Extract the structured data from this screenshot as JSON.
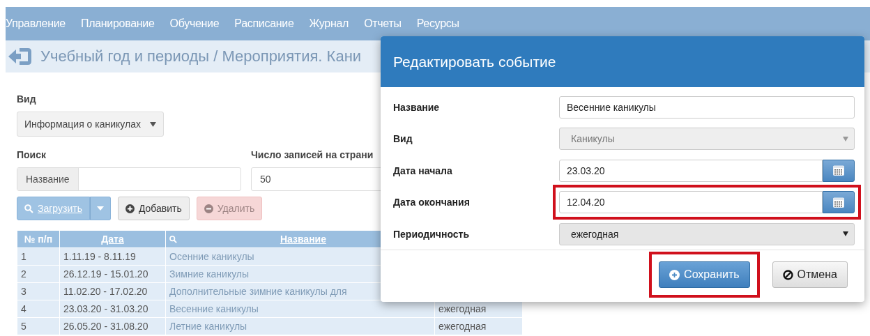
{
  "nav": {
    "items": [
      "Управление",
      "Планирование",
      "Обучение",
      "Расписание",
      "Журнал",
      "Отчеты",
      "Ресурсы"
    ]
  },
  "breadcrumb": {
    "title": "Учебный год и периоды / Мероприятия. Кани"
  },
  "filters": {
    "view_label": "Вид",
    "view_value": "Информация о каникулах",
    "search_label": "Поиск",
    "search_prefix": "Название",
    "per_page_label": "Число записей на страни",
    "per_page_value": "50"
  },
  "actions": [
    {
      "label": "Загрузить",
      "kind": "load"
    },
    {
      "label": "Добавить",
      "kind": "add"
    },
    {
      "label": "Удалить",
      "kind": "delete",
      "disabled": true
    }
  ],
  "table": {
    "columns": [
      "№ п/п",
      "Дата",
      "Название"
    ],
    "rows": [
      {
        "n": "1",
        "date": "1.11.19 - 8.11.19",
        "name": "Осенние каникулы"
      },
      {
        "n": "2",
        "date": "26.12.19 - 15.01.20",
        "name": "Зимние каникулы"
      },
      {
        "n": "3",
        "date": "11.02.20 - 17.02.20",
        "name": "Дополнительные зимние каникулы для"
      },
      {
        "n": "4",
        "date": "23.03.20 - 31.03.20",
        "name": "Весенние каникулы",
        "column_4": "ежегодная"
      },
      {
        "n": "5",
        "date": "26.05.20 - 31.08.20",
        "name": "Летние каникулы",
        "column_4": "ежегодная"
      }
    ]
  },
  "modal": {
    "title": "Редактировать событие",
    "fields": [
      {
        "label": "Название",
        "kind": "text",
        "value": "Весенние каникулы",
        "highlighted": false
      },
      {
        "label": "Вид",
        "kind": "select",
        "value": "Каникулы",
        "disabled": true,
        "highlighted": false
      },
      {
        "label": "Дата начала",
        "kind": "date",
        "value": "23.03.20",
        "highlighted": false
      },
      {
        "label": "Дата окончания",
        "kind": "date",
        "value": "12.04.20",
        "highlighted": true
      },
      {
        "label": "Периодичность",
        "kind": "select",
        "value": "ежегодная",
        "disabled": false,
        "highlighted": false
      }
    ],
    "buttons": [
      {
        "label": "Сохранить",
        "kind": "save",
        "highlighted": true
      },
      {
        "label": "Отмена",
        "kind": "cancel",
        "highlighted": false
      }
    ]
  }
}
